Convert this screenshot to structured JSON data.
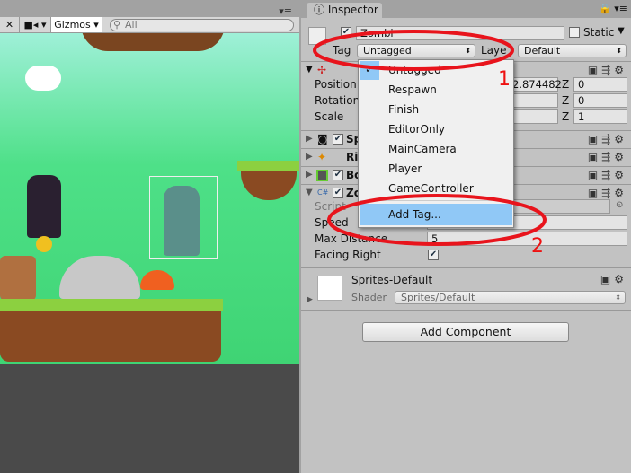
{
  "scene": {
    "gizmos_label": "Gizmos",
    "search_placeholder": "All"
  },
  "inspector": {
    "tab_label": "Inspector",
    "object_name": "Zombi",
    "static_label": "Static",
    "tag_label": "Tag",
    "tag_value": "Untagged",
    "layer_label": "Laye",
    "layer_value": "Default",
    "transform": {
      "position_label": "Position",
      "rotation_label": "Rotation",
      "scale_label": "Scale",
      "position_y": "2.874482",
      "z_label": "Z",
      "position_z": "0",
      "rotation_z": "0",
      "scale_z": "1"
    },
    "components": [
      {
        "label": "Sp"
      },
      {
        "label": "Ri"
      },
      {
        "label": "Bo"
      },
      {
        "label": "Zo"
      }
    ],
    "script_fields": {
      "script_label": "Script",
      "speed_label": "Speed",
      "max_distance_label": "Max Distance",
      "max_distance_value": "5",
      "facing_right_label": "Facing Right",
      "facing_right": true
    },
    "material": {
      "name": "Sprites-Default",
      "shader_label": "Shader",
      "shader_value": "Sprites/Default"
    },
    "add_component": "Add Component"
  },
  "tag_menu": {
    "items": [
      "Untagged",
      "Respawn",
      "Finish",
      "EditorOnly",
      "MainCamera",
      "Player",
      "GameController"
    ],
    "selected": "Untagged",
    "add_tag": "Add Tag..."
  },
  "annotations": {
    "one": "1",
    "two": "2",
    "color": "#e8141c"
  }
}
